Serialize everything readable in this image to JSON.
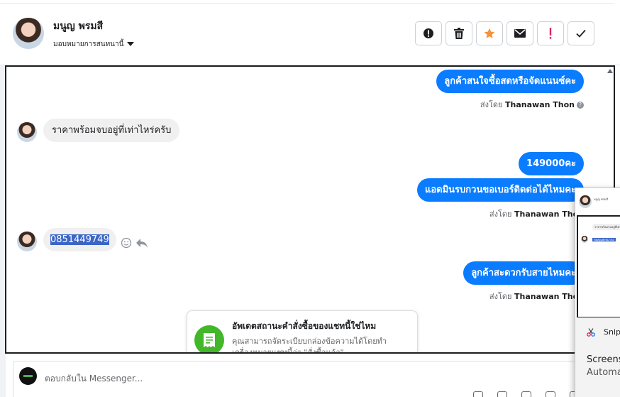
{
  "header": {
    "contact_name": "มนูญ พรมสี",
    "assign_label": "มอบหมายการสนทนานี้"
  },
  "actions": [
    {
      "name": "report-button",
      "icon": "exclamation-circle-icon"
    },
    {
      "name": "delete-button",
      "icon": "trash-icon"
    },
    {
      "name": "star-button",
      "icon": "star-icon",
      "color": "#f7923a"
    },
    {
      "name": "mail-button",
      "icon": "envelope-icon"
    },
    {
      "name": "important-button",
      "icon": "exclamation-icon",
      "color": "#e0245e"
    },
    {
      "name": "done-button",
      "icon": "check-icon"
    }
  ],
  "messages": {
    "m1": "ลูกค้าสนใจซื้อสดหรือจัดแนนซ์คะ",
    "m1_sent_by_prefix": "ส่งโดย",
    "m1_sent_by_name": "Thanawan Thon",
    "m2": "ราคาพร้อมจบอยู่ที่เท่าไหร่ครับ",
    "m3": "149000คะ",
    "m4": "แอดมินรบกวนขอเบอร์ติดต่อได้ไหมคะ",
    "m4_sent_by_prefix": "ส่งโดย",
    "m4_sent_by_name": "Thanawan Thon",
    "m5": "0851449749",
    "m6": "ลูกค้าสะดวกรับสายไหมคะ",
    "m6_sent_by_prefix": "ส่งโดย",
    "m6_sent_by_name": "Thanawan Thon"
  },
  "toast": {
    "title": "อัพเดตสถานะคำสั่งซื้อของแชทนี้ใช่ไหม",
    "body": "คุณสามารถจัดระเบียบกล่องข้อความได้โดยทำเครื่องหมายแชทนี้ว่า \"สั่งซื้อแล้ว\""
  },
  "reply": {
    "placeholder": "ตอบกลับใน Messenger..."
  },
  "popup": {
    "snip_label": "Snip",
    "screens_label": "Screens",
    "automa_label": "Automa",
    "mini_name": "มนูญ พรมสี",
    "mini_msg1": "ราคาพร้อมจบอยู่ที่เท่าไหร่ครับ",
    "mini_msg2": "ขอคุณุพรหมากอ"
  },
  "colors": {
    "accent_blue": "#0a7cff",
    "toast_green": "#42b72a",
    "highlight": "#3a66c8"
  }
}
